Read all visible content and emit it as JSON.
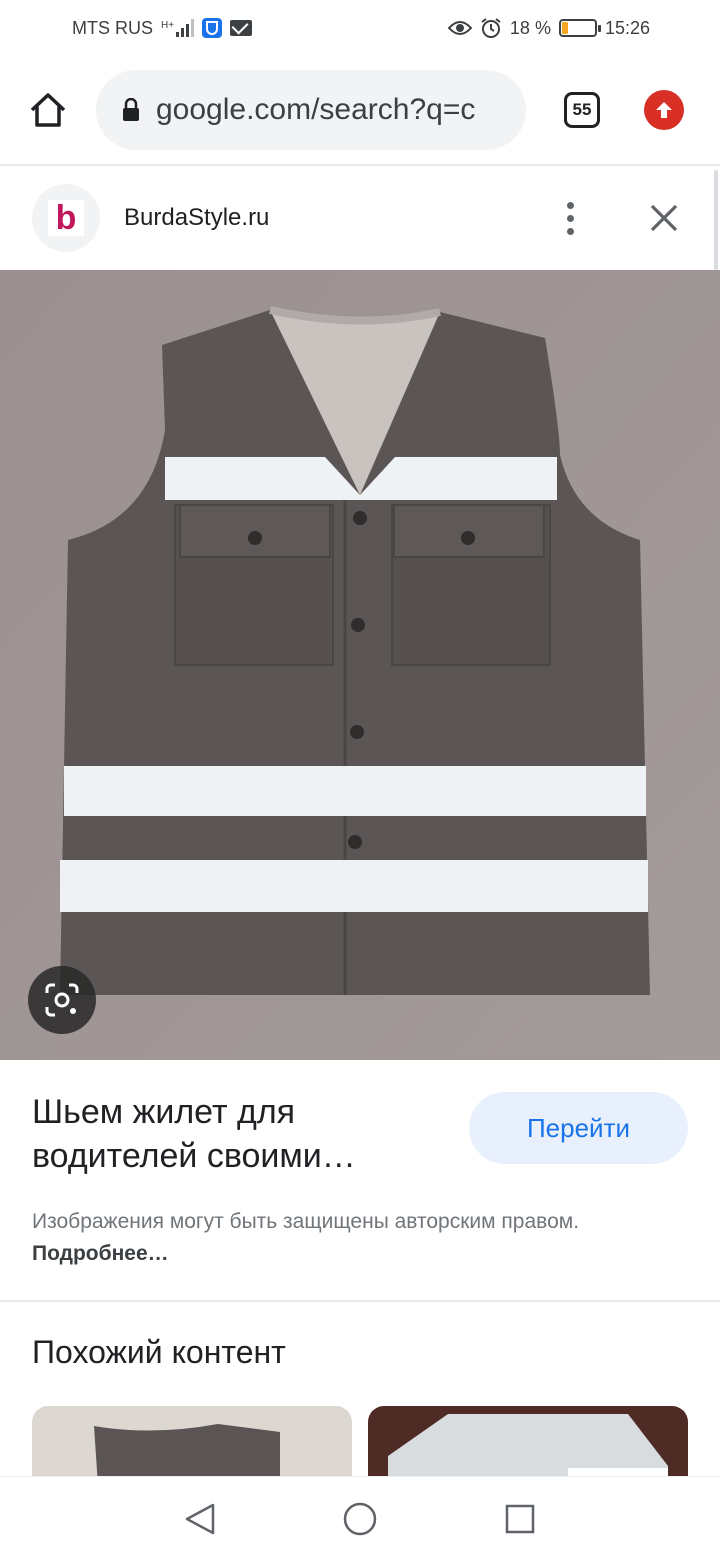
{
  "status_bar": {
    "carrier": "MTS RUS",
    "network_tag": "H+",
    "battery_percent": "18 %",
    "battery_level": 0.18,
    "time": "15:26",
    "icons": [
      "signal-icon",
      "shield-icon",
      "mail-icon",
      "eye-icon",
      "alarm-icon",
      "battery-icon"
    ]
  },
  "browser": {
    "url": "google.com/search?q=c",
    "tab_count": "55",
    "icons": [
      "home-icon",
      "lock-icon",
      "tabs-icon",
      "upload-icon"
    ]
  },
  "source": {
    "favicon_letter": "b",
    "name": "BurdaStyle.ru",
    "icons": [
      "more-vert-icon",
      "close-icon"
    ]
  },
  "result": {
    "title": "Шьем жилет для водителей своими…",
    "open_button": "Перейти",
    "copyright_notice": "Изображения могут быть защищены авторским правом.",
    "learn_more": "Подробнее…",
    "lens_icon": "google-lens-icon"
  },
  "similar": {
    "title": "Похожий контент"
  },
  "navbar": {
    "icons": [
      "back-icon",
      "home-nav-icon",
      "recents-icon"
    ]
  },
  "colors": {
    "accent": "#1a73e8",
    "button_bg": "#e8f0fe",
    "upload": "#d93025",
    "favicon": "#c2185b",
    "battery": "#f5a623"
  }
}
